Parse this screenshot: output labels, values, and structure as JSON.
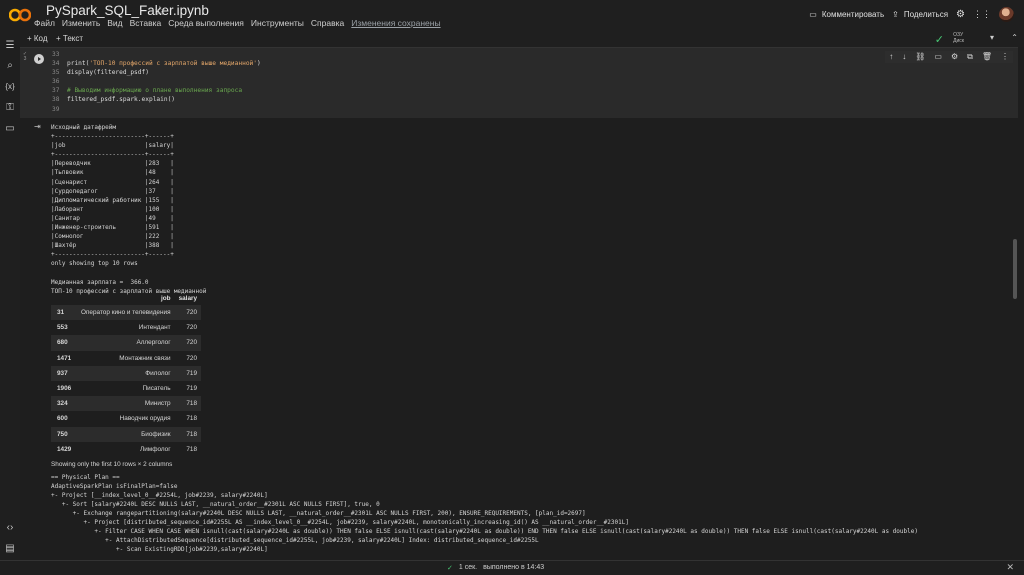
{
  "app": {
    "title": "PySpark_SQL_Faker.ipynb",
    "menu": [
      "Файл",
      "Изменить",
      "Вид",
      "Вставка",
      "Среда выполнения",
      "Инструменты",
      "Справка"
    ],
    "saved_status": "Изменения сохранены",
    "comment_label": "Комментировать",
    "share_label": "Поделиться"
  },
  "toolbar": {
    "add_code": "+ Код",
    "add_text": "+ Текст",
    "ram_label": "ОЗУ",
    "disk_label": "Диск"
  },
  "cell": {
    "lines": [
      {
        "n": "33",
        "parts": [
          {
            "t": "",
            "c": "fn"
          }
        ]
      },
      {
        "n": "34",
        "parts": [
          {
            "t": "print(",
            "c": "fn"
          },
          {
            "t": "'ТОП-10 профессий с зарплатой выше медианной'",
            "c": "str"
          },
          {
            "t": ")",
            "c": "fn"
          }
        ]
      },
      {
        "n": "35",
        "parts": [
          {
            "t": "display(filtered_psdf)",
            "c": "fn"
          }
        ]
      },
      {
        "n": "36",
        "parts": [
          {
            "t": "",
            "c": "fn"
          }
        ]
      },
      {
        "n": "37",
        "parts": [
          {
            "t": "# Выводим информацию о плане выполнения запроса",
            "c": "cm"
          }
        ]
      },
      {
        "n": "38",
        "parts": [
          {
            "t": "filtered_psdf.spark.explain()",
            "c": "fn"
          }
        ]
      },
      {
        "n": "39",
        "parts": [
          {
            "t": "",
            "c": "fn"
          }
        ]
      }
    ]
  },
  "output": {
    "text_block": "Исходный датафрейм\n+-------------------------+------+\n|job                      |salary|\n+-------------------------+------+\n|Переводчик               |283   |\n|Тьпвовик                 |48    |\n|Сценарист                |264   |\n|Сурдопедагог             |37    |\n|Дипломатический работник |155   |\n|Лаборант                 |100   |\n|Санитар                  |49    |\n|Инженер-строитель        |591   |\n|Сомнолог                 |222   |\n|Шахтёр                   |388   |\n+-------------------------+------+\nonly showing top 10 rows\n\nМедианная зарплата =  366.0\nТОП-10 профессий с зарплатой выше медианной",
    "table": {
      "headers": [
        "",
        "job",
        "salary"
      ],
      "rows": [
        [
          "31",
          "Оператор кино и телевидения",
          "720"
        ],
        [
          "553",
          "Интендант",
          "720"
        ],
        [
          "680",
          "Аллерголог",
          "720"
        ],
        [
          "1471",
          "Монтажник связи",
          "720"
        ],
        [
          "937",
          "Филолог",
          "719"
        ],
        [
          "1906",
          "Писатель",
          "719"
        ],
        [
          "324",
          "Министр",
          "718"
        ],
        [
          "600",
          "Наводчик орудия",
          "718"
        ],
        [
          "750",
          "Биофизик",
          "718"
        ],
        [
          "1429",
          "Лимфолог",
          "718"
        ]
      ]
    },
    "caption": "Showing only the first 10 rows × 2 columns",
    "plan": "== Physical Plan ==\nAdaptiveSparkPlan isFinalPlan=false\n+- Project [__index_level_0__#2254L, job#2239, salary#2240L]\n   +- Sort [salary#2240L DESC NULLS LAST, __natural_order__#2301L ASC NULLS FIRST], true, 0\n      +- Exchange rangepartitioning(salary#2240L DESC NULLS LAST, __natural_order__#2301L ASC NULLS FIRST, 200), ENSURE_REQUIREMENTS, [plan_id=2697]\n         +- Project [distributed_sequence_id#2255L AS __index_level_0__#2254L, job#2239, salary#2240L, monotonically_increasing_id() AS __natural_order__#2301L]\n            +- Filter CASE WHEN CASE WHEN isnull(cast(salary#2240L as double)) THEN false ELSE isnull(cast(salary#2240L as double)) END THEN false ELSE isnull(cast(salary#2240L as double)) THEN false ELSE isnull(cast(salary#2240L as double)\n               +- AttachDistributedSequence[distributed_sequence_id#2255L, job#2239, salary#2240L] Index: distributed_sequence_id#2255L\n                  +- Scan ExistingRDD[job#2239,salary#2240L]"
  },
  "status": {
    "duration": "1 сек.",
    "completed": "выполнено в 14:43"
  }
}
